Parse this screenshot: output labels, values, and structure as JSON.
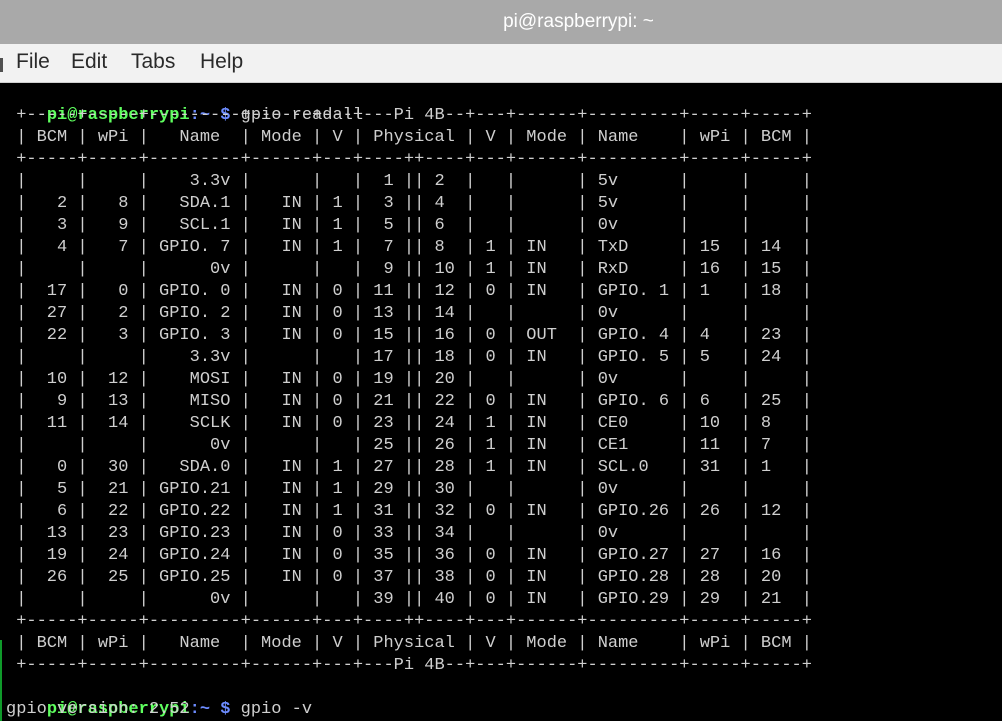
{
  "window": {
    "title": "pi@raspberrypi: ~"
  },
  "menu": {
    "items": [
      "File",
      "Edit",
      "Tabs",
      "Help"
    ]
  },
  "prompt": {
    "user": "pi@raspberrypi",
    "path": ":~",
    "symbol": " $ "
  },
  "commands": {
    "first": "gpio readall",
    "second": "gpio -v"
  },
  "table": {
    "top_border": " +-----+-----+---------+------+---+---Pi 4B--+---+------+---------+-----+-----+",
    "header": " | BCM | wPi |   Name  | Mode | V | Physical | V | Mode | Name    | wPi | BCM |",
    "separator": " +-----+-----+---------+------+---+----++----+---+------+---------+-----+-----+",
    "rows": [
      " |     |     |    3.3v |      |   |  1 || 2  |   |      | 5v      |     |     |",
      " |   2 |   8 |   SDA.1 |   IN | 1 |  3 || 4  |   |      | 5v      |     |     |",
      " |   3 |   9 |   SCL.1 |   IN | 1 |  5 || 6  |   |      | 0v      |     |     |",
      " |   4 |   7 | GPIO. 7 |   IN | 1 |  7 || 8  | 1 | IN   | TxD     | 15  | 14  |",
      " |     |     |      0v |      |   |  9 || 10 | 1 | IN   | RxD     | 16  | 15  |",
      " |  17 |   0 | GPIO. 0 |   IN | 0 | 11 || 12 | 0 | IN   | GPIO. 1 | 1   | 18  |",
      " |  27 |   2 | GPIO. 2 |   IN | 0 | 13 || 14 |   |      | 0v      |     |     |",
      " |  22 |   3 | GPIO. 3 |   IN | 0 | 15 || 16 | 0 | OUT  | GPIO. 4 | 4   | 23  |",
      " |     |     |    3.3v |      |   | 17 || 18 | 0 | IN   | GPIO. 5 | 5   | 24  |",
      " |  10 |  12 |    MOSI |   IN | 0 | 19 || 20 |   |      | 0v      |     |     |",
      " |   9 |  13 |    MISO |   IN | 0 | 21 || 22 | 0 | IN   | GPIO. 6 | 6   | 25  |",
      " |  11 |  14 |    SCLK |   IN | 0 | 23 || 24 | 1 | IN   | CE0     | 10  | 8   |",
      " |     |     |      0v |      |   | 25 || 26 | 1 | IN   | CE1     | 11  | 7   |",
      " |   0 |  30 |   SDA.0 |   IN | 1 | 27 || 28 | 1 | IN   | SCL.0   | 31  | 1   |",
      " |   5 |  21 | GPIO.21 |   IN | 1 | 29 || 30 |   |      | 0v      |     |     |",
      " |   6 |  22 | GPIO.22 |   IN | 1 | 31 || 32 | 0 | IN   | GPIO.26 | 26  | 12  |",
      " |  13 |  23 | GPIO.23 |   IN | 0 | 33 || 34 |   |      | 0v      |     |     |",
      " |  19 |  24 | GPIO.24 |   IN | 0 | 35 || 36 | 0 | IN   | GPIO.27 | 27  | 16  |",
      " |  26 |  25 | GPIO.25 |   IN | 0 | 37 || 38 | 0 | IN   | GPIO.28 | 28  | 20  |",
      " |     |     |      0v |      |   | 39 || 40 | 0 | IN   | GPIO.29 | 29  | 21  |"
    ],
    "footer_header": " | BCM | wPi |   Name  | Mode | V | Physical | V | Mode | Name    | wPi | BCM |",
    "bottom_border": " +-----+-----+---------+------+---+---Pi 4B--+---+------+---------+-----+-----+"
  },
  "output": {
    "version": "gpio version: 2.52"
  }
}
